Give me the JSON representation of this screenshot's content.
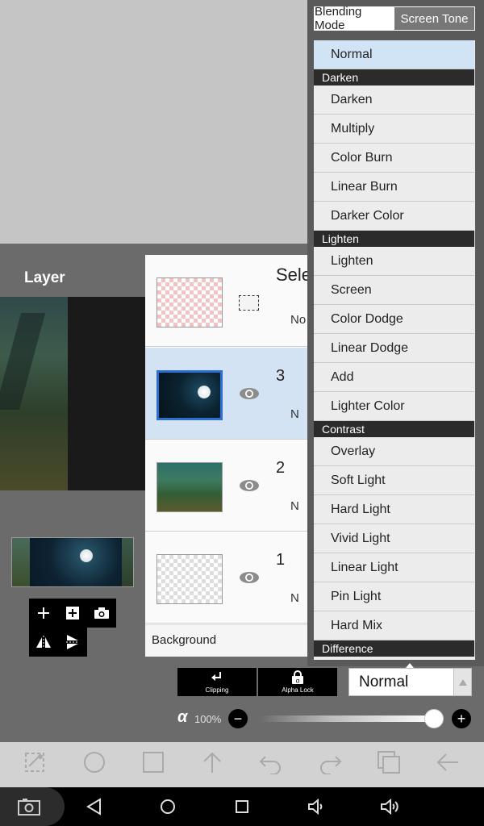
{
  "app": {
    "accent": "#d4e3f4",
    "panel_color": "#6b6b6b"
  },
  "layer_panel": {
    "title": "Layer",
    "selection_layer": {
      "label": "Selec",
      "sub": "No"
    },
    "layers": [
      {
        "number": "3",
        "sub": "N",
        "selected": true,
        "thumb": "moon"
      },
      {
        "number": "2",
        "sub": "N",
        "selected": false,
        "thumb": "forest"
      },
      {
        "number": "1",
        "sub": "N",
        "selected": false,
        "thumb": "transparent"
      }
    ],
    "background_label": "Background"
  },
  "blend_dropdown": {
    "tabs": [
      {
        "label": "Blending Mode",
        "active": true
      },
      {
        "label": "Screen Tone",
        "active": false
      }
    ],
    "items": {
      "normal": "Normal",
      "darken_header": "Darken",
      "darken": "Darken",
      "multiply": "Multiply",
      "color_burn": "Color Burn",
      "linear_burn": "Linear Burn",
      "darker_color": "Darker Color",
      "lighten_header": "Lighten",
      "lighten": "Lighten",
      "screen": "Screen",
      "color_dodge": "Color Dodge",
      "linear_dodge": "Linear Dodge",
      "add": "Add",
      "lighter_color": "Lighter Color",
      "contrast_header": "Contrast",
      "overlay": "Overlay",
      "soft_light": "Soft Light",
      "hard_light": "Hard Light",
      "vivid_light": "Vivid Light",
      "linear_light": "Linear Light",
      "pin_light": "Pin Light",
      "hard_mix": "Hard Mix",
      "difference_header": "Difference"
    },
    "selected": "Normal"
  },
  "controls": {
    "clipping_label": "Clipping",
    "alpha_lock_label": "Alpha Lock",
    "blend_value": "Normal",
    "alpha_symbol": "α",
    "opacity_label": "100%",
    "opacity": 1.0,
    "minus": "−",
    "plus": "+"
  },
  "toolbar": {
    "icons": [
      "transform-icon",
      "circle-icon",
      "square-icon",
      "arrow-up-icon",
      "undo-icon",
      "redo-icon",
      "layers-icon",
      "back-icon"
    ]
  },
  "navbar": {
    "icons": [
      "screenshot-icon",
      "nav-back-icon",
      "nav-home-icon",
      "nav-recents-icon",
      "volume-down-icon",
      "volume-up-icon"
    ]
  }
}
